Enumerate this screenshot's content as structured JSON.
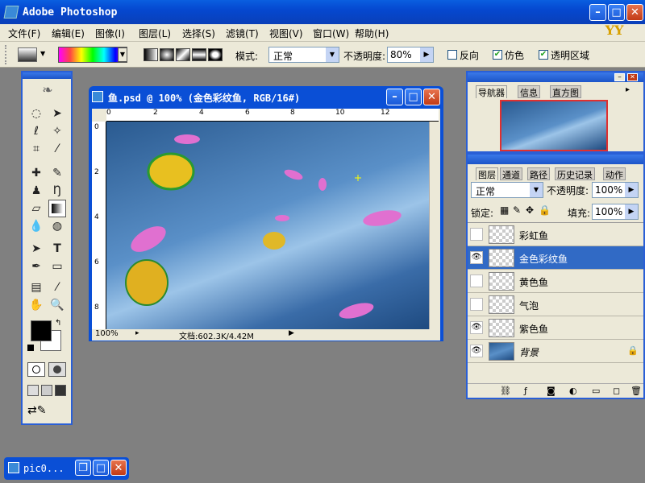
{
  "app": {
    "title": "Adobe Photoshop",
    "logo_text": "YY"
  },
  "menu": [
    "文件(F)",
    "编辑(E)",
    "图像(I)",
    "图层(L)",
    "选择(S)",
    "滤镜(T)",
    "视图(V)",
    "窗口(W)",
    "帮助(H)"
  ],
  "options": {
    "mode_label": "模式:",
    "mode_value": "正常",
    "opacity_label": "不透明度:",
    "opacity_value": "80%",
    "reverse_label": "反向",
    "dither_label": "仿色",
    "transparency_label": "透明区域",
    "dither_checked": true,
    "transparency_checked": true,
    "reverse_checked": false
  },
  "document": {
    "title": "鱼.psd @ 100% (金色彩纹鱼, RGB/16#)",
    "zoom": "100%",
    "doc_info": "文档:602.3K/4.42M",
    "ruler_top": [
      "0",
      "2",
      "4",
      "6",
      "8",
      "10",
      "12"
    ],
    "ruler_left": [
      "0",
      "2",
      "4",
      "6",
      "8"
    ]
  },
  "navigator": {
    "tabs": [
      "导航器",
      "信息",
      "直方图"
    ]
  },
  "layers_panel": {
    "tabs": [
      "图层",
      "通道",
      "路径",
      "历史记录",
      "动作"
    ],
    "blend_mode": "正常",
    "opacity_label": "不透明度:",
    "opacity_value": "100%",
    "lock_label": "锁定:",
    "fill_label": "填充:",
    "fill_value": "100%",
    "layers": [
      {
        "name": "彩虹鱼",
        "visible": false,
        "selected": false
      },
      {
        "name": "金色彩纹鱼",
        "visible": true,
        "selected": true
      },
      {
        "name": "黄色鱼",
        "visible": false,
        "selected": false
      },
      {
        "name": "气泡",
        "visible": false,
        "selected": false
      },
      {
        "name": "紫色鱼",
        "visible": true,
        "selected": false
      },
      {
        "name": "背景",
        "visible": true,
        "selected": false,
        "locked": true
      }
    ]
  },
  "taskbar": {
    "item_label": "pic0..."
  }
}
